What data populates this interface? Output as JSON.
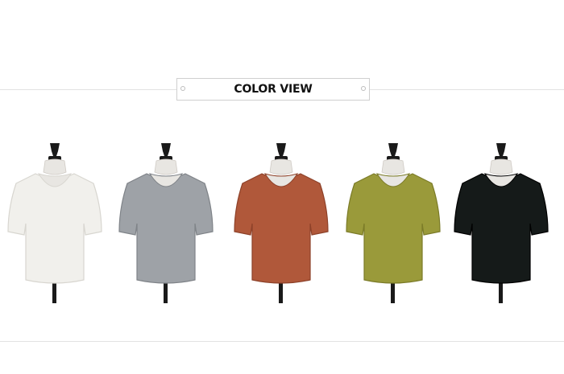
{
  "header": {
    "title": "COLOR VIEW"
  },
  "items": [
    {
      "color_name": "ivory",
      "fill": "#f1f0ec",
      "stroke": "#d8d6d0"
    },
    {
      "color_name": "gray",
      "fill": "#9ea2a7",
      "stroke": "#7f8388"
    },
    {
      "color_name": "brick",
      "fill": "#b0583a",
      "stroke": "#8d4129"
    },
    {
      "color_name": "olive",
      "fill": "#9a9a3a",
      "stroke": "#7b7b28"
    },
    {
      "color_name": "black",
      "fill": "#151a19",
      "stroke": "#000000"
    }
  ]
}
